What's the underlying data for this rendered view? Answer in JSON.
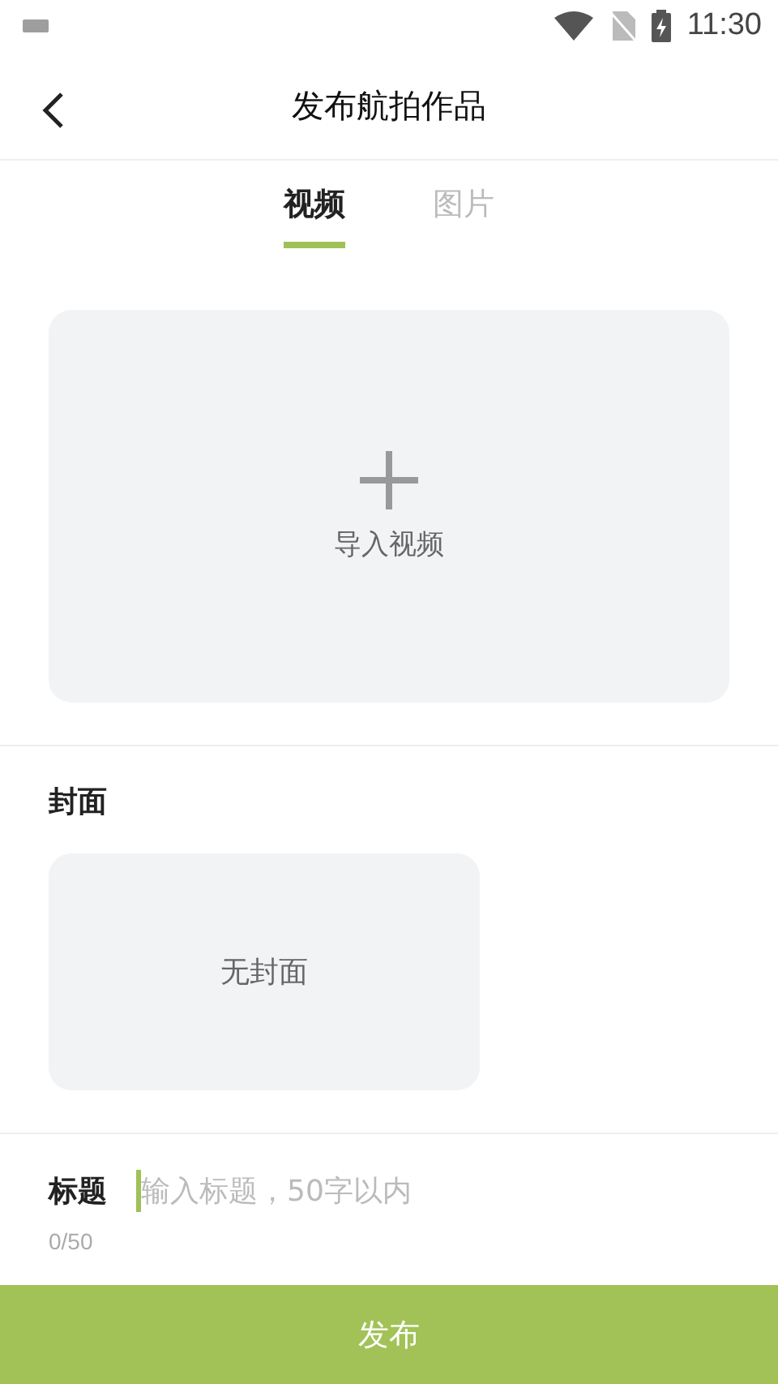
{
  "status_bar": {
    "time": "11:30"
  },
  "header": {
    "title": "发布航拍作品"
  },
  "tabs": [
    {
      "label": "视频",
      "selected": true
    },
    {
      "label": "图片",
      "selected": false
    }
  ],
  "upload": {
    "label": "导入视频"
  },
  "cover": {
    "heading": "封面",
    "placeholder_text": "无封面"
  },
  "title_field": {
    "label": "标题",
    "placeholder": "输入标题，50字以内",
    "counter": "0/50"
  },
  "submit_button": {
    "label": "发布"
  }
}
